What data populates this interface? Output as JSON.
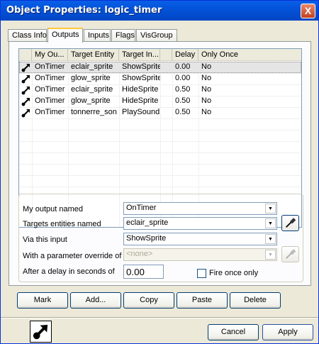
{
  "window": {
    "title": "Object Properties: logic_timer",
    "close_label": "X"
  },
  "tabs": [
    {
      "label": "Class Info"
    },
    {
      "label": "Outputs"
    },
    {
      "label": "Inputs"
    },
    {
      "label": "Flags"
    },
    {
      "label": "VisGroup"
    }
  ],
  "list": {
    "columns": [
      "My Ou...",
      "Target Entity",
      "Target In...",
      "Delay",
      "Only Once"
    ],
    "rows": [
      {
        "output": "OnTimer",
        "target": "eclair_sprite",
        "input": "ShowSprite",
        "delay": "0.00",
        "once": "No"
      },
      {
        "output": "OnTimer",
        "target": "glow_sprite",
        "input": "ShowSprite",
        "delay": "0.00",
        "once": "No"
      },
      {
        "output": "OnTimer",
        "target": "eclair_sprite",
        "input": "HideSprite",
        "delay": "0.50",
        "once": "No"
      },
      {
        "output": "OnTimer",
        "target": "glow_sprite",
        "input": "HideSprite",
        "delay": "0.50",
        "once": "No"
      },
      {
        "output": "OnTimer",
        "target": "tonnerre_son",
        "input": "PlaySound",
        "delay": "0.50",
        "once": "No"
      }
    ]
  },
  "form": {
    "output_label": "My output named",
    "output_value": "OnTimer",
    "targets_label": "Targets entities named",
    "targets_value": "eclair_sprite",
    "input_label": "Via this input",
    "input_value": "ShowSprite",
    "param_label": "With a parameter override of",
    "param_value": "<none>",
    "delay_label": "After a delay in seconds of",
    "delay_value": "0.00",
    "fire_once_label": "Fire once only",
    "fire_once_checked": false
  },
  "buttons": {
    "mark": "Mark",
    "add": "Add...",
    "copy": "Copy",
    "paste": "Paste",
    "delete": "Delete",
    "cancel": "Cancel",
    "apply": "Apply"
  },
  "icons": {
    "output_row": "output-arrow-icon",
    "eyedropper": "eyedropper-icon",
    "big": "output-arrow-icon"
  }
}
